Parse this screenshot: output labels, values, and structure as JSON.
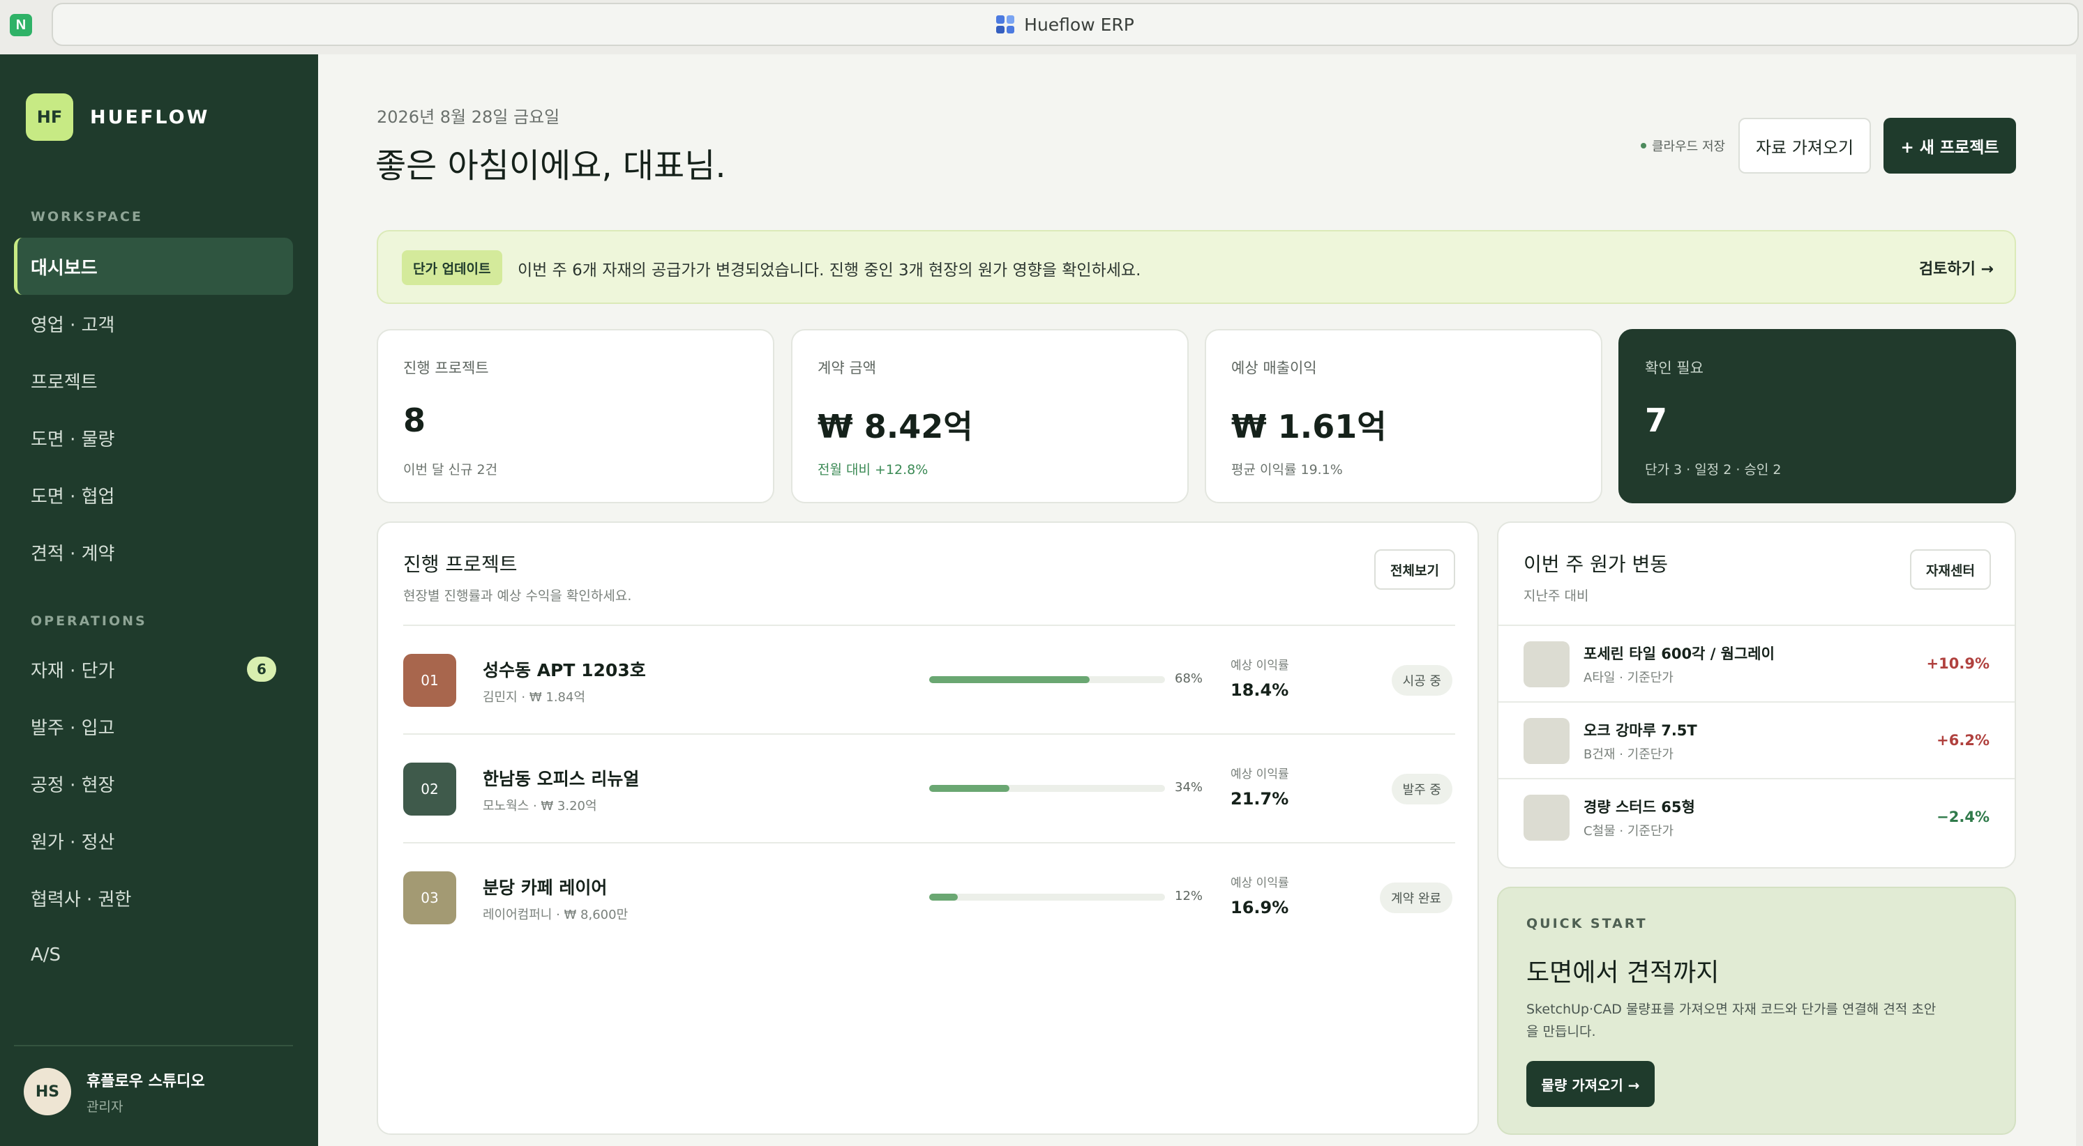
{
  "window": {
    "address_title": "Hueflow ERP"
  },
  "sidebar": {
    "brand_logo": "HF",
    "brand_name": "HUEFLOW",
    "section_workspace": "WORKSPACE",
    "section_operations": "OPERATIONS",
    "workspace_items": [
      {
        "label": "대시보드",
        "active": true
      },
      {
        "label": "영업 · 고객"
      },
      {
        "label": "프로젝트"
      },
      {
        "label": "도면 · 물량"
      },
      {
        "label": "도면 · 협업"
      },
      {
        "label": "견적 · 계약"
      }
    ],
    "operations_items": [
      {
        "label": "자재 · 단가",
        "badge": "6"
      },
      {
        "label": "발주 · 입고"
      },
      {
        "label": "공정 · 현장"
      },
      {
        "label": "원가 · 정산"
      },
      {
        "label": "협력사 · 권한"
      },
      {
        "label": "A/S"
      }
    ],
    "user": {
      "initials": "HS",
      "name": "휴플로우 스튜디오",
      "role": "관리자"
    }
  },
  "header": {
    "date": "2026년 8월 28일 금요일",
    "greeting": "좋은 아침이에요, 대표님.",
    "cloud_status": "클라우드 저장",
    "import_button": "자료 가져오기",
    "new_project_button": "+ 새 프로젝트"
  },
  "banner": {
    "tag": "단가 업데이트",
    "message": "이번 주 6개 자재의 공급가가 변경되었습니다. 진행 중인 3개 현장의 원가 영향을 확인하세요.",
    "link": "검토하기 →"
  },
  "kpis": [
    {
      "label": "진행 프로젝트",
      "value": "8",
      "sub": "이번 달 신규 2건"
    },
    {
      "label": "계약 금액",
      "value": "₩ 8.42억",
      "sub": "전월 대비 +12.8%"
    },
    {
      "label": "예상 매출이익",
      "value": "₩ 1.61억",
      "sub": "평균 이익률 19.1%"
    },
    {
      "label": "확인 필요",
      "value": "7",
      "sub": "단가 3 · 일정 2 · 승인 2"
    }
  ],
  "projects_panel": {
    "title": "진행 프로젝트",
    "subtitle": "현장별 진행률과 예상 수익을 확인하세요.",
    "view_all": "전체보기",
    "margin_label": "예상 이익률",
    "items": [
      {
        "num": "01",
        "name": "성수동 APT 1203호",
        "meta": "김민지 · ₩ 1.84억",
        "progress": 0.68,
        "progress_label": "68%",
        "margin": "18.4%",
        "status": "시공 중",
        "color": "#a8664d"
      },
      {
        "num": "02",
        "name": "한남동 오피스 리뉴얼",
        "meta": "모노웍스 · ₩ 3.20억",
        "progress": 0.34,
        "progress_label": "34%",
        "margin": "21.7%",
        "status": "발주 중",
        "color": "#3f5a4b"
      },
      {
        "num": "03",
        "name": "분당 카페 레이어",
        "meta": "레이어컴퍼니 · ₩ 8,600만",
        "progress": 0.12,
        "progress_label": "12%",
        "margin": "16.9%",
        "status": "계약 완료",
        "color": "#a39a73"
      }
    ]
  },
  "cost_panel": {
    "title": "이번 주 원가 변동",
    "subtitle": "지난주 대비",
    "button": "자재센터",
    "items": [
      {
        "name": "포세린 타일 600각 / 웜그레이",
        "meta": "A타일 · 기준단가",
        "change": "+10.9%",
        "direction": "up"
      },
      {
        "name": "오크 강마루 7.5T",
        "meta": "B건재 · 기준단가",
        "change": "+6.2%",
        "direction": "up"
      },
      {
        "name": "경량 스터드 65형",
        "meta": "C철물 · 기준단가",
        "change": "−2.4%",
        "direction": "down"
      }
    ]
  },
  "quick_start": {
    "eyebrow": "QUICK START",
    "title": "도면에서 견적까지",
    "description": "SketchUp·CAD 물량표를 가져오면 자재 코드와 단가를 연결해 견적 초안을 만듭니다.",
    "button": "물량 가져오기 →"
  },
  "colors": {
    "sidebar": "#1f3b2c",
    "accent": "#c7ea84",
    "up": "#b0413e",
    "down": "#2f7a4a"
  }
}
